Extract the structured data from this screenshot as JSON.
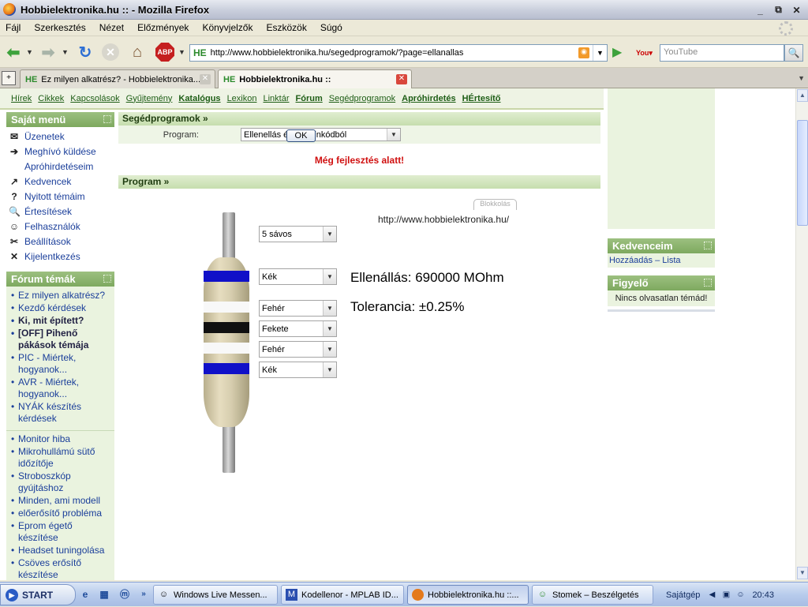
{
  "window": {
    "title": "Hobbielektronika.hu :: - Mozilla Firefox",
    "controls": [
      "_",
      "⧉",
      "✕"
    ]
  },
  "menubar": [
    "Fájl",
    "Szerkesztés",
    "Nézet",
    "Előzmények",
    "Könyvjelzők",
    "Eszközök",
    "Súgó"
  ],
  "navbar": {
    "url_site_badge": "HE",
    "url": "http://www.hobbielektronika.hu/segedprogramok/?page=ellanallas",
    "search_engine": "YouTube",
    "search_placeholder": "YouTube",
    "abp_label": "ABP"
  },
  "tabs": [
    {
      "badge": "HE",
      "label": "Ez milyen alkatrész? - Hobbielektronika...",
      "active": false
    },
    {
      "badge": "HE",
      "label": "Hobbielektronika.hu ::",
      "active": true
    }
  ],
  "site_nav": [
    {
      "label": "Hírek",
      "bold": false
    },
    {
      "label": "Cikkek",
      "bold": false
    },
    {
      "label": "Kapcsolások",
      "bold": false
    },
    {
      "label": "Gyűjtemény",
      "bold": false
    },
    {
      "label": "Katalógus",
      "bold": true
    },
    {
      "label": "Lexikon",
      "bold": false
    },
    {
      "label": "Linktár",
      "bold": false
    },
    {
      "label": "Fórum",
      "bold": true
    },
    {
      "label": "Segédprogramok",
      "bold": false
    },
    {
      "label": "Apróhirdetés",
      "bold": true
    },
    {
      "label": "HÉrtesítő",
      "bold": true
    }
  ],
  "sajat_menu": {
    "title": "Saját menü",
    "items": [
      {
        "icon": "envelope-icon",
        "glyph": "✉",
        "label": "Üzenetek"
      },
      {
        "icon": "invite-icon",
        "glyph": "➔",
        "label": "Meghívó küldése"
      },
      {
        "icon": "",
        "glyph": "",
        "label": "Apróhirdetéseim"
      },
      {
        "icon": "favorite-icon",
        "glyph": "↗",
        "label": "Kedvencek"
      },
      {
        "icon": "question-icon",
        "glyph": "?",
        "label": "Nyitott témáim"
      },
      {
        "icon": "magnifier-icon",
        "glyph": "🔍",
        "label": "Értesítések"
      },
      {
        "icon": "user-icon",
        "glyph": "☺",
        "label": "Felhasználók"
      },
      {
        "icon": "tools-icon",
        "glyph": "✂",
        "label": "Beállítások"
      },
      {
        "icon": "exit-icon",
        "glyph": "✕",
        "label": "Kijelentkezés"
      }
    ]
  },
  "forum_temak": {
    "title": "Fórum témák",
    "group1": [
      {
        "label": "Ez milyen alkatrész?",
        "bold": false
      },
      {
        "label": "Kezdő kérdések",
        "bold": false
      },
      {
        "label": "Ki, mit épített?",
        "bold": true
      },
      {
        "label": "[OFF] Pihenő pákások témája",
        "bold": true
      },
      {
        "label": "PIC - Miértek, hogyanok...",
        "bold": false
      },
      {
        "label": "AVR - Miértek, hogyanok...",
        "bold": false
      },
      {
        "label": "NYÁK készítés kérdések",
        "bold": false
      }
    ],
    "group2": [
      {
        "label": "Monitor hiba",
        "bold": false
      },
      {
        "label": "Mikrohullámú sütő időzítője",
        "bold": false
      },
      {
        "label": "Stroboszkóp gyújtáshoz",
        "bold": false
      },
      {
        "label": "Minden, ami modell",
        "bold": false
      },
      {
        "label": "előerősítő probléma",
        "bold": false
      },
      {
        "label": "Eprom égető készítése",
        "bold": false
      },
      {
        "label": "Headset tuningolása",
        "bold": false
      },
      {
        "label": "Csöves erősítő készítése",
        "bold": false
      }
    ]
  },
  "segedprogramok": {
    "title": "Segédprogramok »",
    "program_label": "Program:",
    "program_value": "Ellenellás érték színkódból",
    "ok_label": "OK",
    "dev_notice": "Még fejlesztés alatt!"
  },
  "program": {
    "title": "Program »",
    "blokkolas": "Blokkolás",
    "site_url": "http://www.hobbielektronika.hu/",
    "band_count": "5 sávos",
    "bands": [
      "Kék",
      "Fehér",
      "Fekete",
      "Fehér",
      "Kék"
    ],
    "band_colors": [
      "#1010C8",
      "#F8F8F8",
      "#101010",
      "#F8F8F8",
      "#1010C8"
    ],
    "resistance": "Ellenállás: 690000 MOhm",
    "tolerance": "Tolerancia: ±0.25%"
  },
  "right": {
    "kedvenceim_title": "Kedvenceim",
    "add_label": "Hozzáadás",
    "separator": "–",
    "list_label": "Lista",
    "figyelo_title": "Figyelő",
    "figyelo_text": "Nincs olvasatlan témád!"
  },
  "taskbar": {
    "start": "START",
    "items": [
      {
        "icon": "messenger-icon",
        "label": "Windows Live Messen...",
        "active": false
      },
      {
        "icon": "mplab-icon",
        "label": "Kodellenor - MPLAB ID...",
        "active": false
      },
      {
        "icon": "firefox-icon",
        "label": "Hobbielektronika.hu ::...",
        "active": true
      },
      {
        "icon": "chat-icon",
        "label": "Stomek – Beszélgetés",
        "active": false
      }
    ],
    "sajatgep": "Sajátgép",
    "clock": "20:43"
  },
  "colors": {
    "site_green": "#7EA95F",
    "link_blue": "#1A3E9A",
    "warning_red": "#D01010"
  }
}
